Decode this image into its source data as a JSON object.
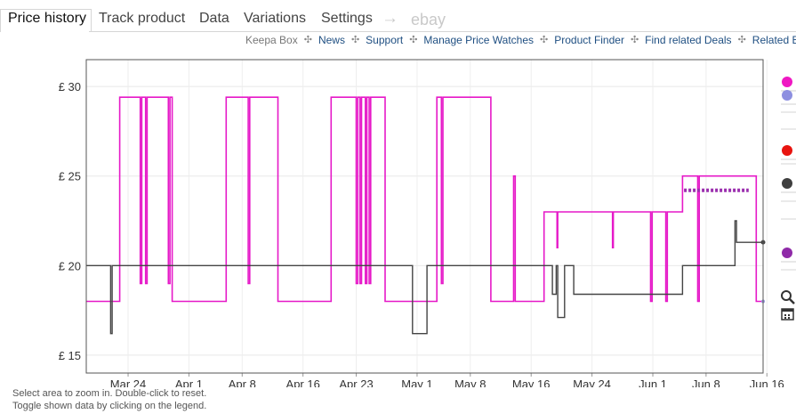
{
  "tabs": {
    "price_history": "Price history",
    "track_product": "Track product",
    "data": "Data",
    "variations": "Variations",
    "settings": "Settings",
    "arrow": "→",
    "ebay": "ebay"
  },
  "subnav": {
    "keepa_box": "Keepa Box",
    "news": "News",
    "support": "Support",
    "manage_price_watches": "Manage Price Watches",
    "product_finder": "Product Finder",
    "find_related_deals": "Find related Deals",
    "related": "Related Be",
    "separator": "✣"
  },
  "hints": {
    "zoom": "Select area to zoom in. Double-click to reset.",
    "legend": "Toggle shown data by clicking on the legend."
  },
  "chart_data": {
    "type": "line",
    "x_unit": "days since Mar 19",
    "xlim": [
      0,
      89
    ],
    "ylim": [
      14,
      31.5
    ],
    "y_ticks": [
      {
        "value": 15,
        "label": "£ 15"
      },
      {
        "value": 20,
        "label": "£ 20"
      },
      {
        "value": 25,
        "label": "£ 25"
      },
      {
        "value": 30,
        "label": "£ 30"
      }
    ],
    "x_ticks": [
      {
        "value": 5.5,
        "label": "Mar 24"
      },
      {
        "value": 13.5,
        "label": "Apr 1"
      },
      {
        "value": 20.5,
        "label": "Apr 8"
      },
      {
        "value": 28.5,
        "label": "Apr 16"
      },
      {
        "value": 35.5,
        "label": "Apr 23"
      },
      {
        "value": 43.5,
        "label": "May 1"
      },
      {
        "value": 50.5,
        "label": "May 8"
      },
      {
        "value": 58.5,
        "label": "May 16"
      },
      {
        "value": 66.5,
        "label": "May 24"
      },
      {
        "value": 74.5,
        "label": "Jun 1"
      },
      {
        "value": 81.5,
        "label": "Jun 8"
      },
      {
        "value": 89.5,
        "label": "Jun 16"
      }
    ],
    "grid": true,
    "series": [
      {
        "color": "#e619c8",
        "points": [
          [
            0,
            18
          ],
          [
            4.4,
            18
          ],
          [
            4.4,
            29.4
          ],
          [
            7.1,
            29.4
          ],
          [
            7.1,
            19
          ],
          [
            7.3,
            19
          ],
          [
            7.3,
            29.4
          ],
          [
            7.8,
            29.4
          ],
          [
            7.8,
            19
          ],
          [
            8,
            19
          ],
          [
            8,
            29.4
          ],
          [
            10.8,
            29.4
          ],
          [
            10.8,
            19
          ],
          [
            11,
            19
          ],
          [
            11,
            29.4
          ],
          [
            11.3,
            29.4
          ],
          [
            11.3,
            18
          ],
          [
            18.4,
            18
          ],
          [
            18.4,
            29.4
          ],
          [
            21.3,
            29.4
          ],
          [
            21.3,
            19
          ],
          [
            21.5,
            19
          ],
          [
            21.5,
            29.4
          ],
          [
            25.2,
            29.4
          ],
          [
            25.2,
            18
          ],
          [
            32.2,
            18
          ],
          [
            32.2,
            29.4
          ],
          [
            35.5,
            29.4
          ],
          [
            35.5,
            19
          ],
          [
            35.7,
            19
          ],
          [
            35.7,
            29.4
          ],
          [
            36,
            29.4
          ],
          [
            36,
            19
          ],
          [
            36.2,
            19
          ],
          [
            36.2,
            29.4
          ],
          [
            36.7,
            29.4
          ],
          [
            36.7,
            19
          ],
          [
            36.9,
            19
          ],
          [
            36.9,
            29.4
          ],
          [
            37.2,
            29.4
          ],
          [
            37.2,
            19
          ],
          [
            37.4,
            19
          ],
          [
            37.4,
            29.4
          ],
          [
            39.3,
            29.4
          ],
          [
            39.3,
            18
          ],
          [
            46.1,
            18
          ],
          [
            46.1,
            29.4
          ],
          [
            46.7,
            29.4
          ],
          [
            46.7,
            19
          ],
          [
            46.9,
            19
          ],
          [
            46.9,
            29.4
          ],
          [
            53.2,
            29.4
          ],
          [
            53.2,
            18
          ],
          [
            56.2,
            18
          ],
          [
            56.2,
            25
          ],
          [
            56.4,
            25
          ],
          [
            56.4,
            18
          ],
          [
            60.2,
            18
          ],
          [
            60.2,
            23
          ],
          [
            61.9,
            23
          ],
          [
            61.9,
            21
          ],
          [
            62,
            21
          ],
          [
            62,
            23
          ],
          [
            69.2,
            23
          ],
          [
            69.2,
            21
          ],
          [
            69.3,
            21
          ],
          [
            69.3,
            23
          ],
          [
            74.2,
            23
          ],
          [
            74.2,
            18
          ],
          [
            74.4,
            18
          ],
          [
            74.4,
            23
          ],
          [
            76.2,
            23
          ],
          [
            76.2,
            18
          ],
          [
            76.4,
            18
          ],
          [
            76.4,
            23
          ],
          [
            78.4,
            23
          ],
          [
            78.4,
            25
          ],
          [
            80.4,
            25
          ],
          [
            80.4,
            18
          ],
          [
            80.6,
            18
          ],
          [
            80.6,
            25
          ],
          [
            88.1,
            25
          ],
          [
            88.1,
            18
          ],
          [
            89,
            18
          ]
        ]
      },
      {
        "color": "#444444",
        "points": [
          [
            0,
            20
          ],
          [
            3.2,
            20
          ],
          [
            3.2,
            16.2
          ],
          [
            3.4,
            16.2
          ],
          [
            3.4,
            20
          ],
          [
            42.9,
            20
          ],
          [
            42.9,
            16.2
          ],
          [
            44.8,
            16.2
          ],
          [
            44.8,
            20
          ],
          [
            61.3,
            20
          ],
          [
            61.3,
            18.4
          ],
          [
            61.8,
            18.4
          ],
          [
            61.8,
            20
          ],
          [
            62,
            20
          ],
          [
            62,
            17.1
          ],
          [
            62.9,
            17.1
          ],
          [
            62.9,
            20
          ],
          [
            64.1,
            20
          ],
          [
            64.1,
            18.4
          ],
          [
            78.4,
            18.4
          ],
          [
            78.4,
            20
          ],
          [
            85.3,
            20
          ],
          [
            85.3,
            22.5
          ],
          [
            85.5,
            22.5
          ],
          [
            85.5,
            21.3
          ],
          [
            89,
            21.3
          ]
        ]
      },
      {
        "color": "#9b2fae",
        "points": [
          [
            78.6,
            24.2
          ],
          [
            87.1,
            24.2
          ]
        ]
      }
    ],
    "legend": [
      {
        "color": "#ef18c3"
      },
      {
        "color": "#8d8fe0"
      },
      {
        "color": "#e8140f"
      },
      {
        "color": "#3f3f3f"
      },
      {
        "color": "#8f2aa8"
      }
    ],
    "icons": [
      "search-icon",
      "calendar-icon"
    ]
  }
}
